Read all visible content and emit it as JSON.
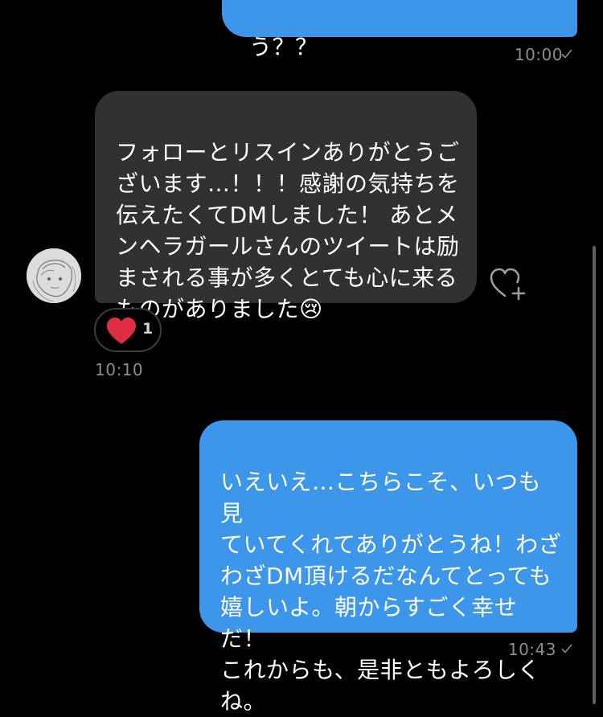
{
  "messages": {
    "top_sent": {
      "text": "う？？",
      "time": "10:00"
    },
    "received": {
      "text": "フォローとリスインありがとうご\nざいます…！！！感謝の気持ちを\n伝えたくてDMしました！ あとメ\nンヘラガールさんのツイートは励\nまされる事が多くとても心に来る\nものがありました😢",
      "reaction_emoji": "heart-icon",
      "reaction_count": "1",
      "time": "10:10"
    },
    "sent": {
      "text": "いえいえ…こちらこそ、いつも見\nていてくれてありがとうね！わざ\nわざDM頂けるだなんてとっても\n嬉しいよ。朝からすごく幸せだ！\nこれからも、是非ともよろしく\nね。",
      "time": "10:43"
    }
  },
  "colors": {
    "sent_bubble": "#3c96ea",
    "received_bubble": "#2f3133",
    "heart": "#e0245e",
    "timestamp": "#8a8d91"
  }
}
